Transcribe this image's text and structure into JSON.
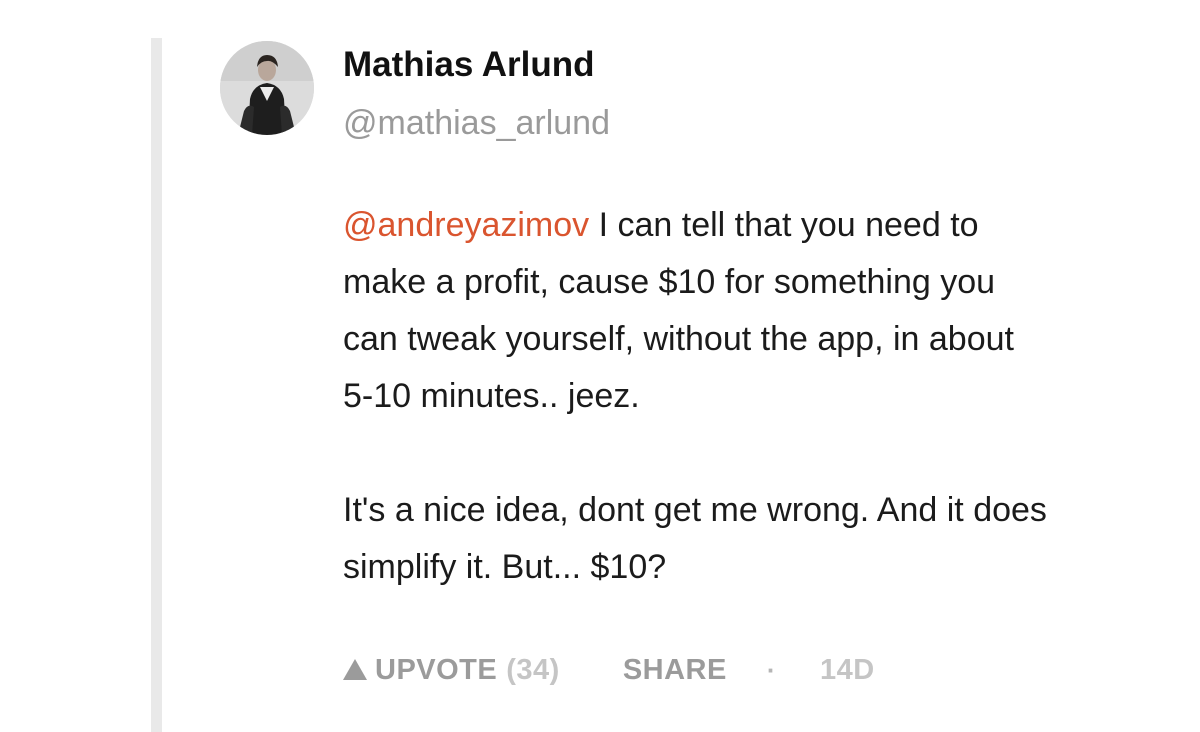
{
  "comment": {
    "author": {
      "name": "Mathias Arlund",
      "handle": "@mathias_arlund"
    },
    "body": {
      "mention": "@andreyazimov",
      "paragraph1_lines": [
        " I can tell that you need to",
        "make a profit, cause $10 for something you",
        "can tweak yourself, without the app, in about",
        "5-10 minutes.. jeez."
      ],
      "paragraph2_lines": [
        "It's a nice idea, dont get me wrong. And it does",
        "simplify it. But... $10?"
      ]
    },
    "actions": {
      "upvote_label": "UPVOTE",
      "upvote_count": "(34)",
      "share_label": "SHARE",
      "separator": "·",
      "age": "14D"
    }
  },
  "colors": {
    "mention": "#da552f",
    "name": "#111111",
    "muted": "#9b9b9b",
    "thread_line": "#e9e9e9"
  },
  "icons": {
    "upvote": "triangle-up-icon",
    "avatar": "user-photo"
  }
}
